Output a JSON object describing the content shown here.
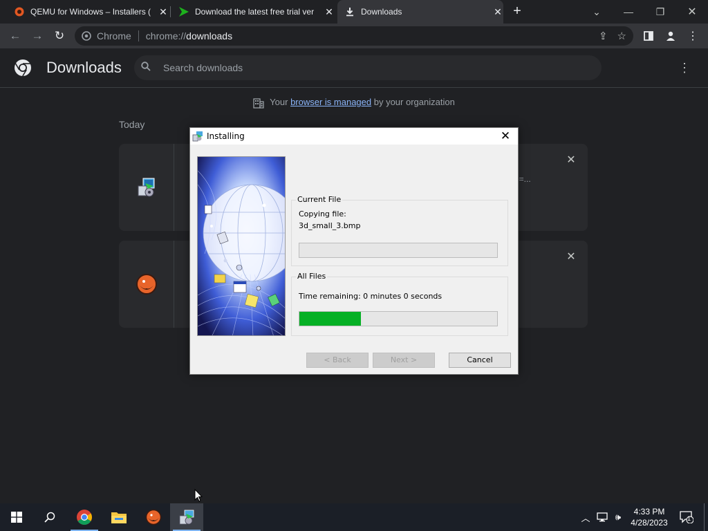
{
  "browser": {
    "tabs": [
      {
        "title": "QEMU for Windows – Installers (",
        "icon": "qemu-icon",
        "active": false
      },
      {
        "title": "Download the latest free trial ver",
        "icon": "arrow-icon",
        "active": false
      },
      {
        "title": "Downloads",
        "icon": "download-icon",
        "active": true
      }
    ],
    "omnibox": {
      "chip": "Chrome",
      "scheme": "chrome://",
      "host": "downloads"
    }
  },
  "downloads_page": {
    "title": "Downloads",
    "search_placeholder": "Search downloads",
    "managed_prefix": "Your ",
    "managed_link": "browser is managed",
    "managed_suffix": " by your organization",
    "section": "Today",
    "items": [
      {
        "icon": "installer-icon",
        "tail_text": "me=..."
      },
      {
        "icon": "qemu-icon",
        "tail_text": ""
      }
    ]
  },
  "installer": {
    "title": "Installing",
    "current_file_label": "Current File",
    "copying_label": "Copying file:",
    "file_name": "3d_small_3.bmp",
    "current_progress": 0,
    "all_files_label": "All Files",
    "time_remaining": "Time remaining: 0 minutes 0 seconds",
    "all_progress": 0.31,
    "buttons": {
      "back": "< Back",
      "next": "Next >",
      "cancel": "Cancel"
    }
  },
  "taskbar": {
    "time": "4:33 PM",
    "date": "4/28/2023",
    "notification_count": "1"
  },
  "colors": {
    "progress_green": "#06b025",
    "link_blue": "#8ab4f8"
  }
}
